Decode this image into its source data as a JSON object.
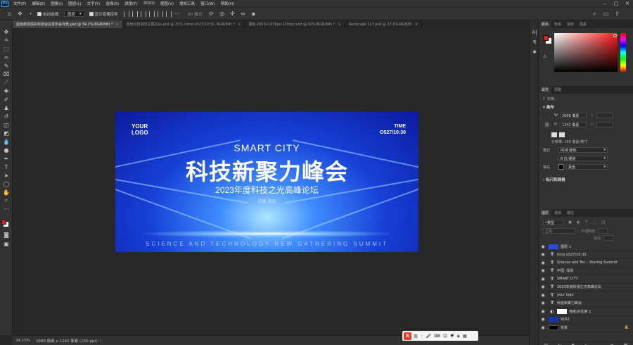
{
  "menu": {
    "app_icon": "Ps",
    "items": [
      "文件(F)",
      "编辑(E)",
      "图像(I)",
      "图层(L)",
      "文字(Y)",
      "选择(S)",
      "滤镜(T)",
      "3D(D)",
      "视图(V)",
      "增效工具",
      "窗口(W)",
      "帮助(H)"
    ]
  },
  "options": {
    "auto_select_label": "自动选择:",
    "auto_select_value": "图层",
    "show_transform_label": "显示变换控件",
    "mode_3d_label": "3D 模式:"
  },
  "tabs": [
    {
      "label": "蓝色新变炫彩科技会议发布会背景.psd @ 34.2%(RGB/8#) *"
    },
    {
      "label": "蓝色科技城市主题主kv.psd @ 25% (time o527/10:30, RGB/8#) *"
    },
    {
      "label": "展板-2953x1476px-150dpi.psd @ 50%(RGB/8#) *"
    },
    {
      "label": "Rectangle 112.psd @ 37.6%(RGB/8)"
    }
  ],
  "artwork": {
    "logo_line1": "YOUR",
    "logo_line2": "LOGO",
    "time_label": "TIME",
    "time_value": "O527/10:30",
    "subtitle_en": "SMART CITY",
    "title_cn": "科技新聚力峰会",
    "subtitle_cn": "2023年度科技之光高峰论坛",
    "location": "中国·深圳",
    "footer_en": "SCIENCE AND TECHNOLOGY NEW GATHERING SUMMIT"
  },
  "status": {
    "zoom": "34.15%",
    "doc_size": "2688 像素 x 1242 像素 (150 ppi)"
  },
  "ime": {
    "logo": "S",
    "lang": "英"
  },
  "color_panel": {
    "tabs": [
      "颜色",
      "色板",
      "渐变",
      "图案"
    ],
    "fg_color": "#e8191a",
    "bg_color": "#ffffff"
  },
  "properties_panel": {
    "tabs": [
      "属性",
      "调整"
    ],
    "doc_label": "文档",
    "canvas_title": "画布",
    "w_label": "W",
    "w_value": "2688 像素",
    "h_label": "H",
    "h_value": "1242 像素",
    "x_label": "X",
    "y_label": "Y",
    "resolution": "分辨率: 150 像素/英寸",
    "mode_label": "模式",
    "mode_value": "RGB 颜色",
    "depth_value": "8 位/通道",
    "fill_label": "填充",
    "fill_value": "黑色",
    "rulers_title": "标尺和网格"
  },
  "layers_panel": {
    "tabs": [
      "图层",
      "通道",
      "路径"
    ],
    "filter_label": "类型",
    "blend_mode": "正常",
    "opacity_label": "不透明度:",
    "fill_label": "填充:",
    "layers": [
      {
        "kind": "image",
        "name": "图层 1"
      },
      {
        "kind": "text",
        "name": "time o527/10:30"
      },
      {
        "kind": "text",
        "name": "Science and Tec....thering Summit"
      },
      {
        "kind": "text",
        "name": "中国 ·深圳"
      },
      {
        "kind": "text",
        "name": "SMART CITY"
      },
      {
        "kind": "text",
        "name": "2023年度科技之光高峰论坛"
      },
      {
        "kind": "text",
        "name": "your logo"
      },
      {
        "kind": "text",
        "name": "科技新聚力峰会"
      },
      {
        "kind": "adjust",
        "name": "亮度/对比度 1"
      },
      {
        "kind": "image",
        "name": "9162"
      },
      {
        "kind": "fill",
        "name": "背景"
      }
    ]
  }
}
